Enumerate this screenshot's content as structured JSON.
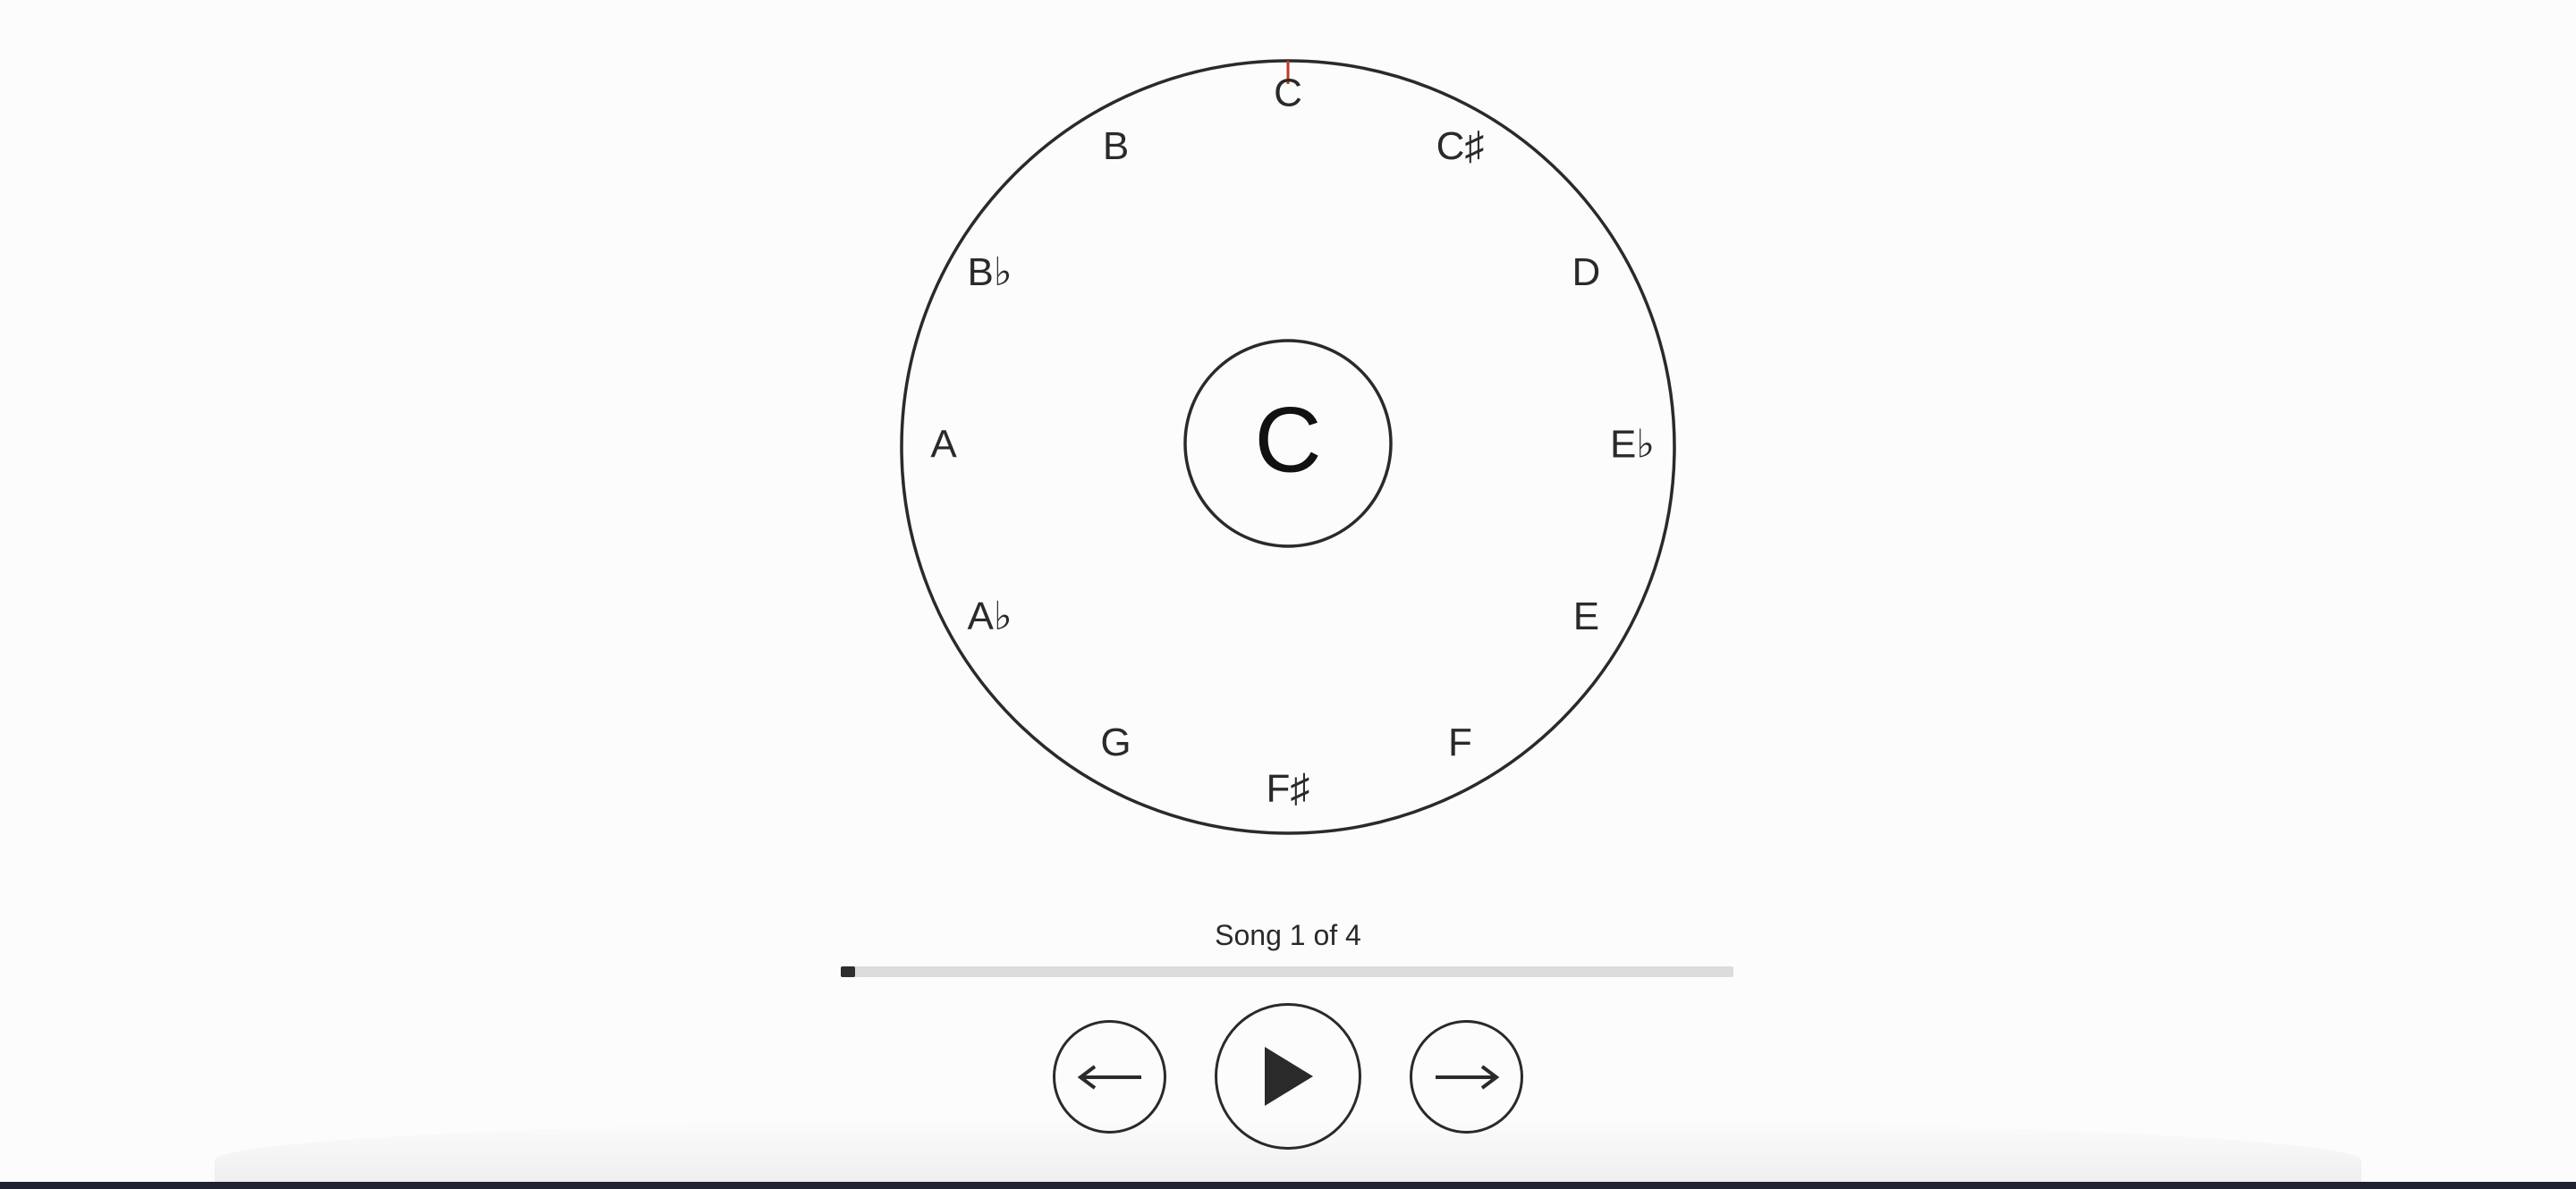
{
  "wheel": {
    "current_key": "C",
    "notes": [
      "C",
      "C♯",
      "D",
      "E♭",
      "E",
      "F",
      "F♯",
      "G",
      "A♭",
      "A",
      "B♭",
      "B"
    ],
    "pointer_color": "#c0392b"
  },
  "player": {
    "status": "Song 1 of 4",
    "progress": 0.01,
    "prev_icon": "arrow-left-icon",
    "play_icon": "play-icon",
    "next_icon": "arrow-right-icon"
  }
}
